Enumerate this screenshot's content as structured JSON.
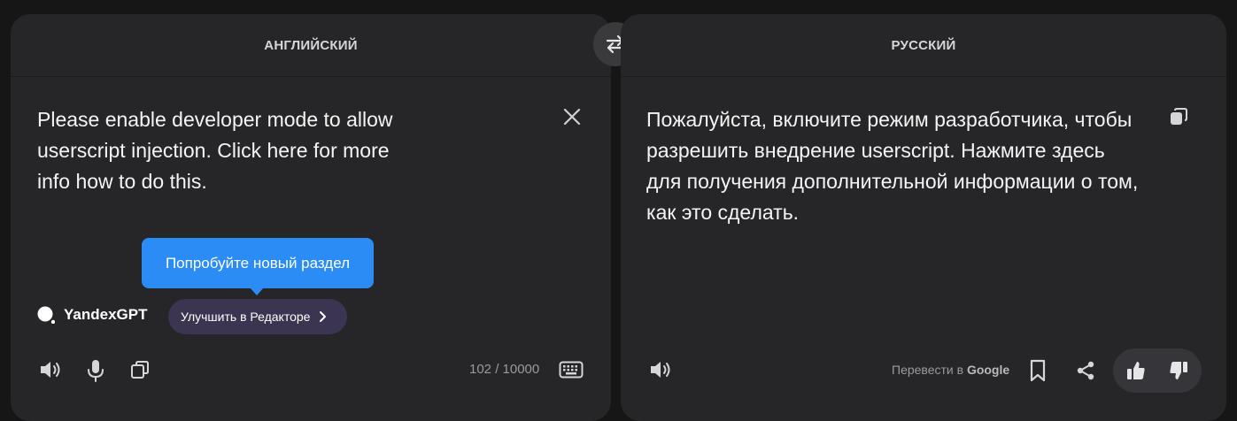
{
  "source": {
    "language": "АНГЛИЙСКИЙ",
    "text": "Please enable developer mode to allow userscript injection. Click here for more info how to do this.",
    "counter": "102 / 10000"
  },
  "target": {
    "language": "РУССКИЙ",
    "text": "Пожалуйста, включите режим разработчика, чтобы\nразрешить внедрение userscript. Нажмите здесь\nдля получения дополнительной информации о том, как это сделать."
  },
  "tooltip": {
    "text": "Попробуйте новый раздел"
  },
  "yandexgpt": {
    "label": "YandexGPT",
    "improve_label": "Улучшить в Редакторе"
  },
  "google": {
    "prefix": "Перевести в ",
    "brand": "Google"
  },
  "icons": {
    "swap": "swap-arrows-icon",
    "clear": "close-icon",
    "speaker": "speaker-icon",
    "mic": "microphone-icon",
    "copy": "copy-icon",
    "keyboard": "keyboard-icon",
    "bookmark": "bookmark-icon",
    "share": "share-icon",
    "like": "thumbs-up-icon",
    "dislike": "thumbs-down-icon"
  }
}
